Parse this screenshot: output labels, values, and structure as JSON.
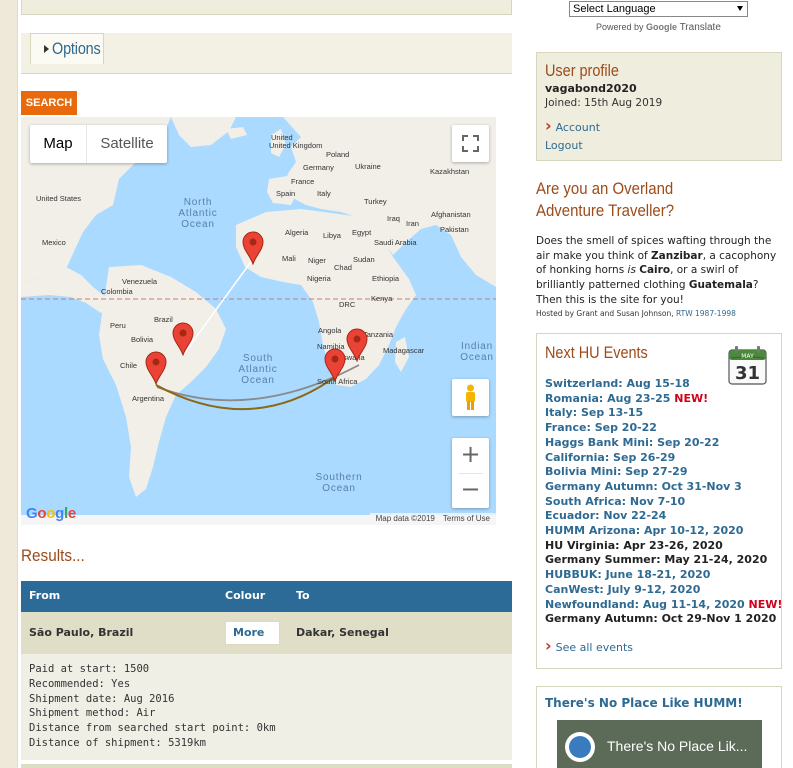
{
  "left": {
    "options_label": "Options",
    "search_label": "SEARCH",
    "map": {
      "map_label": "Map",
      "satellite_label": "Satellite",
      "google_logo": "Google",
      "map_data": "Map data ©2019",
      "terms": "Terms of Use",
      "zoom_in": "+",
      "zoom_out": "−",
      "oceans": {
        "north_atlantic": "North Atlantic Ocean",
        "south_atlantic": "South Atlantic Ocean",
        "indian": "Indian Ocean",
        "southern": "Southern Ocean"
      },
      "places": {
        "united_kingdom": "United Kingdom",
        "poland": "Poland",
        "germany": "Germany",
        "ukraine": "Ukraine",
        "france": "France",
        "kazakhstan": "Kazakhstan",
        "spain": "Spain",
        "italy": "Italy",
        "turkey": "Turkey",
        "united_states": "United States",
        "iraq": "Iraq",
        "iran": "Iran",
        "afghanistan": "Afghanistan",
        "algeria": "Algeria",
        "libya": "Libya",
        "egypt": "Egypt",
        "pakistan": "Pakistan",
        "saudi_arabia": "Saudi Arabia",
        "mexico": "Mexico",
        "mali": "Mali",
        "niger": "Niger",
        "chad": "Chad",
        "sudan": "Sudan",
        "venezuela": "Venezuela",
        "colombia": "Colombia",
        "nigeria": "Nigeria",
        "ethiopia": "Ethiopia",
        "drc": "DRC",
        "kenya": "Kenya",
        "peru": "Peru",
        "brazil": "Brazil",
        "bolivia": "Bolivia",
        "angola": "Angola",
        "tanzania": "Tanzania",
        "madagascar": "Madagascar",
        "namibia": "Namibia",
        "botswana": "swana",
        "chile": "Chile",
        "south_africa": "South Africa",
        "argentina": "Argentina"
      }
    },
    "results": {
      "title": "Results...",
      "columns": [
        "From",
        "Colour",
        "To"
      ],
      "row": {
        "from": "São Paulo, Brazil",
        "more": "More",
        "to": "Dakar, Senegal"
      },
      "details": [
        "Paid at start: 1500",
        "Recommended: Yes",
        "Shipment date: Aug 2016",
        "Shipment method: Air",
        "Distance from searched start point: 0km",
        "Distance of shipment: 5319km"
      ]
    }
  },
  "right": {
    "language_select": "Select Language",
    "powered_by": "Powered by",
    "powered_google": "Google",
    "powered_translate": "Translate",
    "profile": {
      "title": "User profile",
      "username": "vagabond2020",
      "joined": "Joined: 15th Aug 2019",
      "account": "Account",
      "logout": "Logout"
    },
    "overland": {
      "title": "Are you an Overland Adventure Traveller?",
      "text_1": "Does the smell of spices wafting through the air make you think of ",
      "zanzibar": "Zanzibar",
      "text_2": ", a cacophony of honking horns ",
      "is": "is",
      "cairo": "Cairo",
      "text_3": ", or a swirl of brilliantly patterned clothing ",
      "guatemala": "Guatemala",
      "text_4": "? Then this is the site for you!",
      "hosted": "Hosted by Grant and Susan Johnson, ",
      "rtw": "RTW 1987-1998"
    },
    "events": {
      "title": "Next HU Events",
      "cal_month": "MAY",
      "cal_day": "31",
      "items": [
        {
          "text": "Switzerland: Aug 15-18",
          "new": ""
        },
        {
          "text": "Romania: Aug 23-25 ",
          "new": "NEW!"
        },
        {
          "text": "Italy: Sep 13-15",
          "new": ""
        },
        {
          "text": "France: Sep 20-22",
          "new": ""
        },
        {
          "text": "Haggs Bank Mini: Sep 20-22",
          "new": ""
        },
        {
          "text": "California: Sep 26-29",
          "new": ""
        },
        {
          "text": "Bolivia Mini: Sep 27-29",
          "new": ""
        },
        {
          "text": "Germany Autumn: Oct 31-Nov 3",
          "new": ""
        },
        {
          "text": "South Africa: Nov 7-10",
          "new": ""
        },
        {
          "text": "Ecuador: Nov 22-24",
          "new": ""
        },
        {
          "text": "HUMM Arizona: Apr 10-12, 2020",
          "new": ""
        },
        {
          "text": "HU Virginia: Apr 23-26, 2020",
          "new": ""
        },
        {
          "text": "Germany Summer: May 21-24, 2020",
          "new": ""
        },
        {
          "text": "HUBBUK: June 18-21, 2020",
          "new": ""
        },
        {
          "text": "CanWest: July 9-12, 2020",
          "new": ""
        },
        {
          "text": "Newfoundland: Aug 11-14, 2020 ",
          "new": "NEW!"
        },
        {
          "text": "Germany Autumn: Oct 29-Nov 1 2020",
          "new": ""
        }
      ],
      "see_all": "See all events"
    },
    "humm": {
      "title": "There's No Place Like HUMM!",
      "video_title": "There's No Place Lik..."
    }
  },
  "colors": {
    "accent_orange": "#e96a0d",
    "heading_brown": "#9d4b19",
    "link_blue": "#2e6a92",
    "table_header": "#2c6a97",
    "new_red": "#d0021b"
  }
}
